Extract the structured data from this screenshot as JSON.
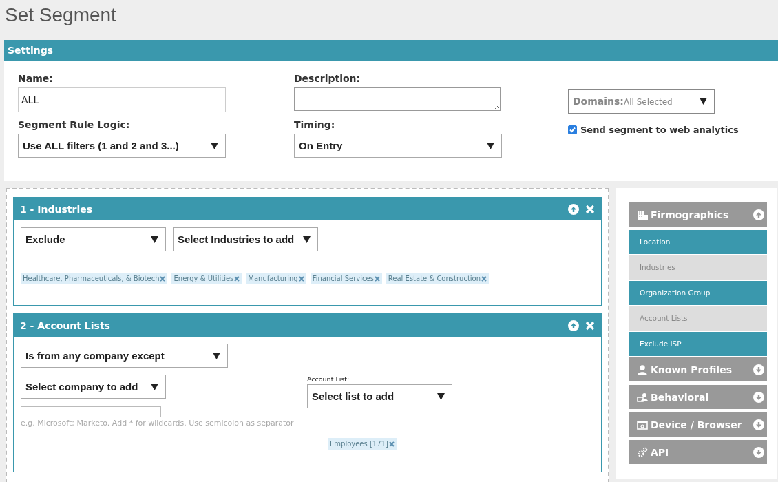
{
  "page": {
    "title": "Set Segment"
  },
  "settings": {
    "title": "Settings",
    "name": {
      "label": "Name:",
      "value": "ALL"
    },
    "description": {
      "label": "Description:"
    },
    "domains": {
      "label": "Domains:",
      "value": "All Selected",
      "disabled": true
    },
    "rule_logic": {
      "label": "Segment Rule Logic:",
      "value": "Use ALL filters (1 and 2 and 3...)"
    },
    "timing": {
      "label": "Timing:",
      "value": "On Entry"
    },
    "send_to_analytics": {
      "label": "Send segment to web analytics",
      "checked": true
    }
  },
  "filters": [
    {
      "kind": "industries",
      "title": "1 - Industries",
      "mode": "Exclude",
      "picker": "Select Industries to add",
      "tags": [
        "Healthcare, Pharmaceuticals, & Biotech",
        "Energy & Utilities",
        "Manufacturing",
        "Financial Services",
        "Real Estate & Construction"
      ]
    },
    {
      "kind": "account_lists",
      "title": "2 - Account Lists",
      "mode": "Is from any company except",
      "picker": "Select company to add",
      "hint": "e.g. Microsoft; Marketo. Add * for wildcards. Use semicolon as separator",
      "list_label": "Account List:",
      "list_picker": "Select list to add",
      "tags": [
        "Employees [171]"
      ]
    }
  ],
  "sidebar": {
    "categories": [
      {
        "label": "Firmographics",
        "expanded": true,
        "items": [
          {
            "label": "Location",
            "disabled": false
          },
          {
            "label": "Industries",
            "disabled": true
          },
          {
            "label": "Organization Group",
            "disabled": false
          },
          {
            "label": "Account Lists",
            "disabled": true
          },
          {
            "label": "Exclude ISP",
            "disabled": false
          }
        ]
      },
      {
        "label": "Known Profiles",
        "expanded": false
      },
      {
        "label": "Behavioral",
        "expanded": false
      },
      {
        "label": "Device / Browser",
        "expanded": false
      },
      {
        "label": "API",
        "expanded": false
      }
    ]
  }
}
